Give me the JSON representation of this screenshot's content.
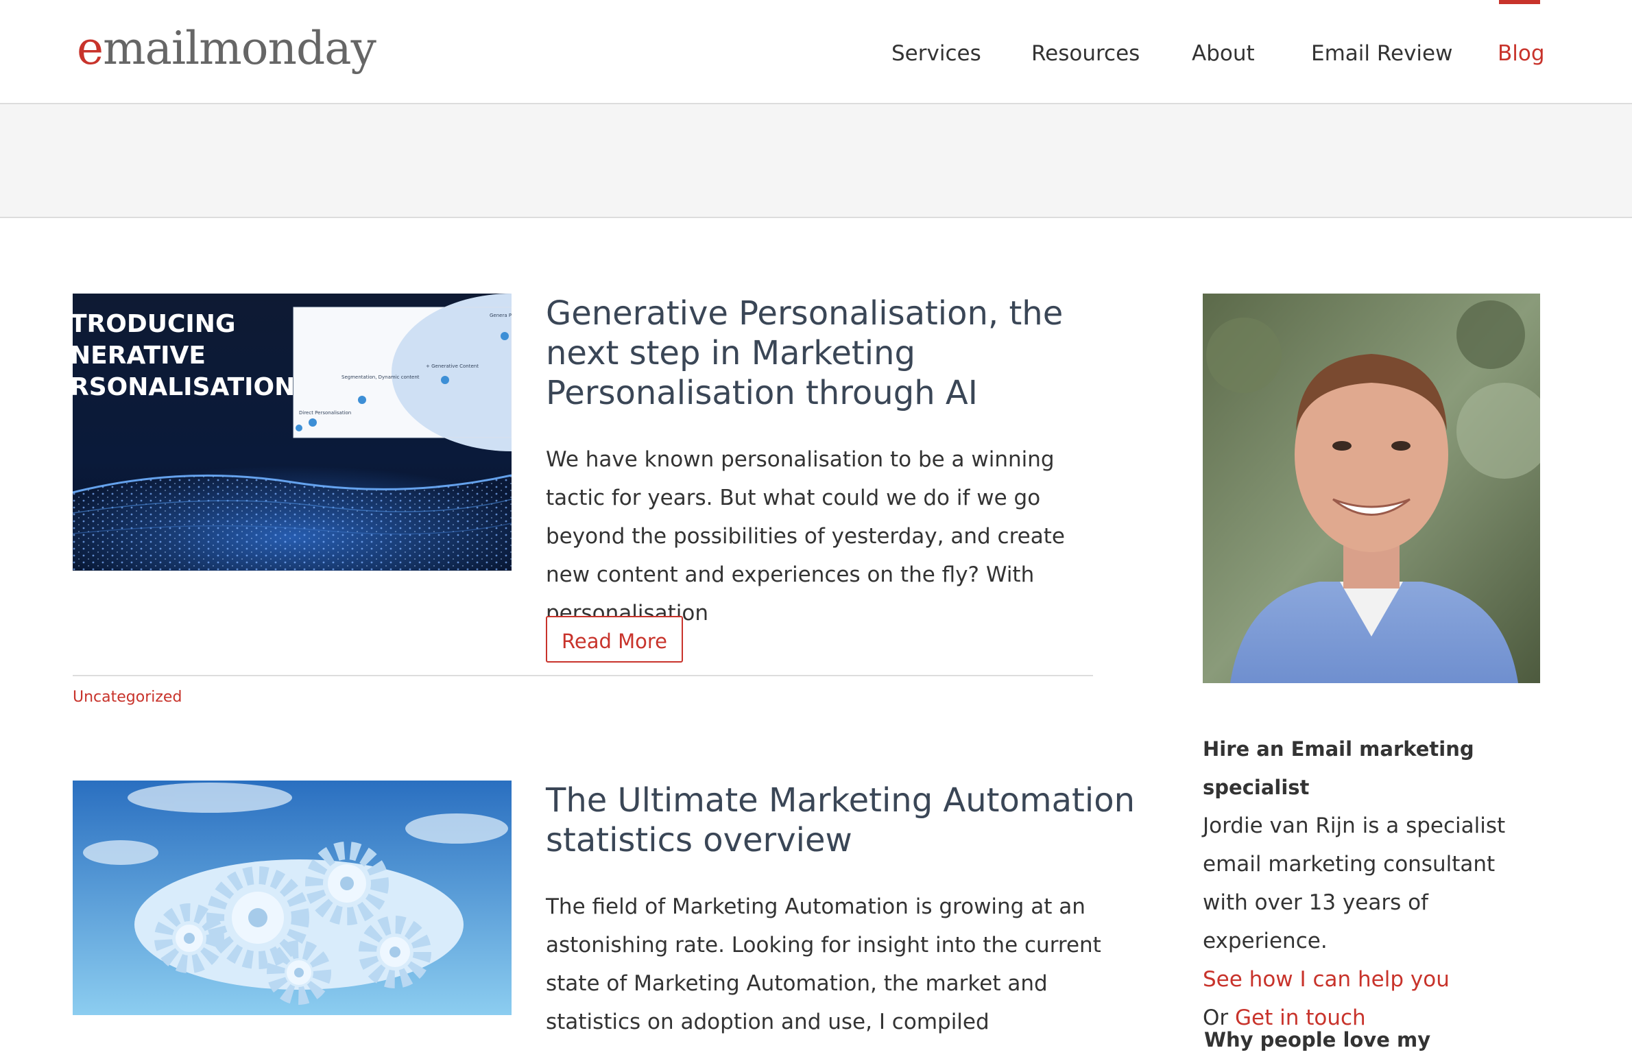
{
  "header": {
    "logo_e": "e",
    "logo_rest": "mailmonday",
    "nav": [
      "Services",
      "Resources",
      "About",
      "Email Review",
      "Blog"
    ],
    "active_nav": "Blog"
  },
  "posts": [
    {
      "title": "Generative Personalisation, the next step in Marketing Personalisation through AI",
      "excerpt": "We have known personalisation to be a winning tactic for years. But what could we do if we go beyond the possibilities of yesterday, and create new content and experiences on the fly? With personalisation",
      "read_more": "Read More",
      "category": "Uncategorized",
      "image": {
        "lines": [
          "TRODUCING",
          "NERATIVE",
          "RSONALISATION"
        ],
        "chart_labels": [
          "Genera Persona",
          "+ Generative Content",
          "Segmentation, Dynamic content",
          "Direct Personalisation"
        ]
      }
    },
    {
      "title": "The Ultimate Marketing Automation statistics overview",
      "excerpt": "The field of Marketing Automation is growing at an astonishing rate. Looking for insight into the current state of Marketing Automation, the market and statistics on adoption and use, I compiled"
    }
  ],
  "sidebar": {
    "heading": "Hire an Email marketing specialist",
    "bio": "Jordie van Rijn is a specialist email marketing consultant with over 13 years of experience.",
    "help_link": "See how I can help you",
    "or_text": "Or",
    "contact_link": "Get in touch",
    "next_heading": "Why people love my"
  },
  "colors": {
    "accent": "#c8332b",
    "title": "#3a4656",
    "band": "#f5f5f5"
  }
}
